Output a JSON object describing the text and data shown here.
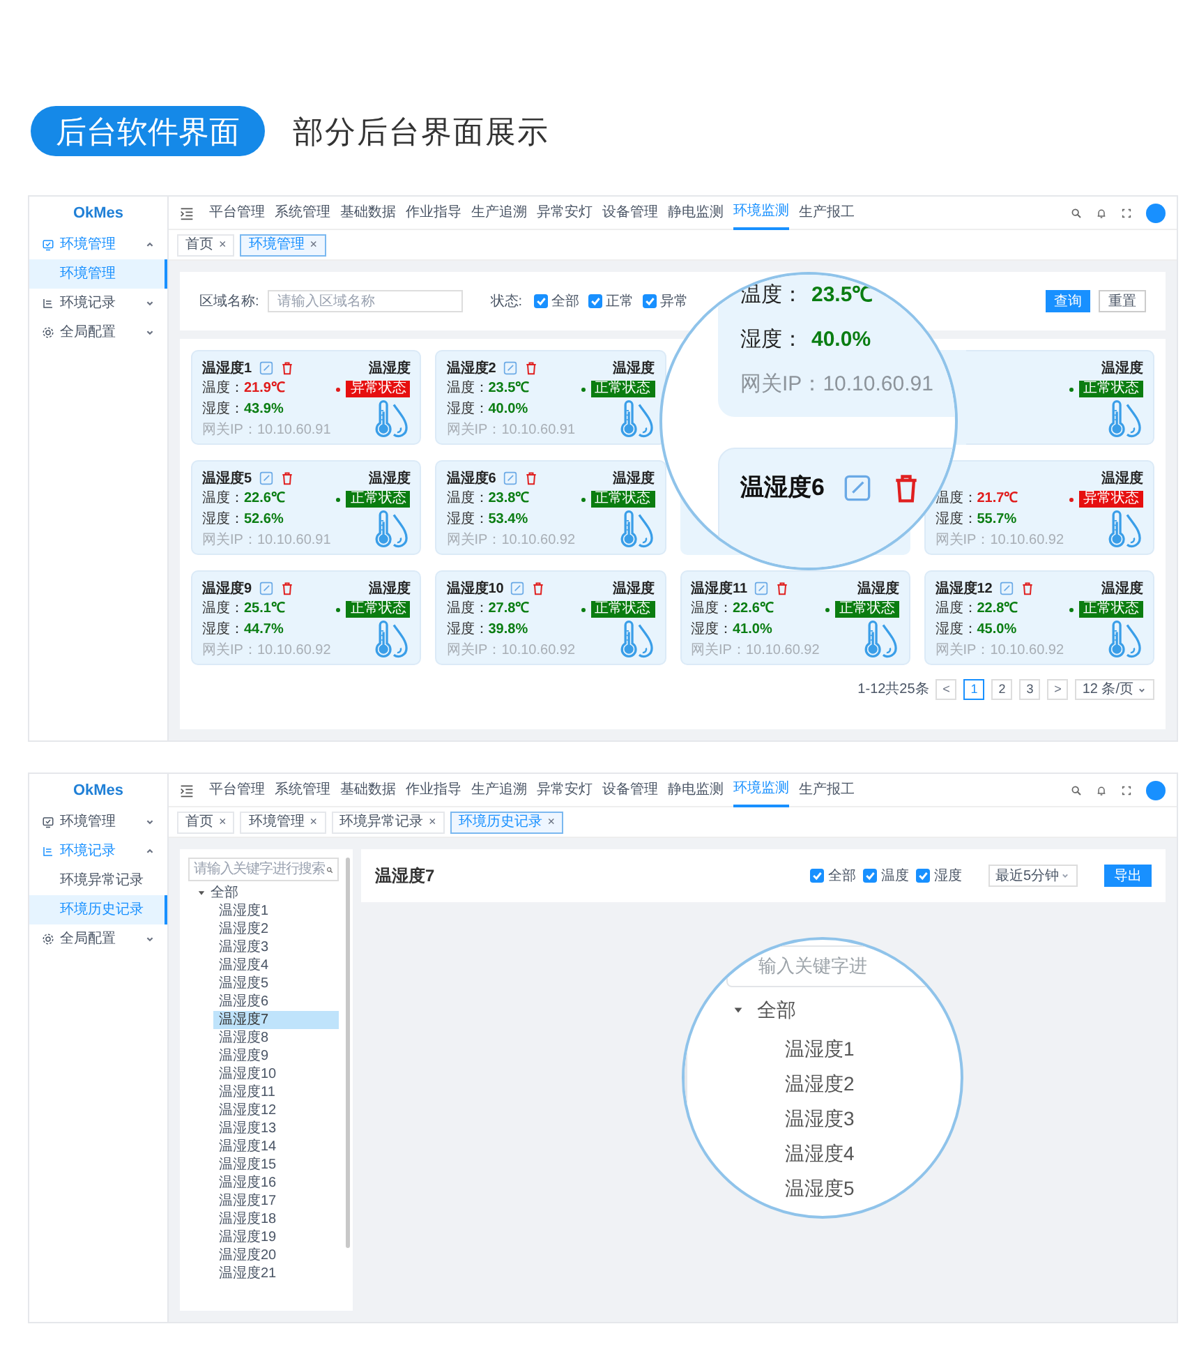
{
  "header": {
    "badge": "后台软件界面",
    "subtitle": "部分后台界面展示"
  },
  "screens": [
    {
      "kind": "monitor",
      "logo": "OkMes",
      "nav": [
        {
          "label": "平台管理",
          "selected": false
        },
        {
          "label": "系统管理",
          "selected": false
        },
        {
          "label": "基础数据",
          "selected": false
        },
        {
          "label": "作业指导",
          "selected": false
        },
        {
          "label": "生产追溯",
          "selected": false
        },
        {
          "label": "异常安灯",
          "selected": false
        },
        {
          "label": "设备管理",
          "selected": false
        },
        {
          "label": "静电监测",
          "selected": false
        },
        {
          "label": "环境监测",
          "selected": true
        },
        {
          "label": "生产报工",
          "selected": false
        }
      ],
      "sidebar": [
        {
          "label": "环境管理",
          "expanded": true,
          "active": true,
          "children": [
            {
              "label": "环境管理",
              "selected": true
            }
          ]
        },
        {
          "label": "环境记录",
          "expanded": false,
          "active": false
        },
        {
          "label": "全局配置",
          "expanded": false,
          "active": false
        }
      ],
      "tabs": [
        {
          "label": "首页",
          "close": "×",
          "selected": false
        },
        {
          "label": "环境管理",
          "close": "×",
          "selected": true
        }
      ],
      "filter": {
        "area_label": "区域名称:",
        "area_placeholder": "请输入区域名称",
        "status_label": "状态:",
        "checks": [
          {
            "label": "全部",
            "checked": true
          },
          {
            "label": "正常",
            "checked": true
          },
          {
            "label": "异常",
            "checked": true
          }
        ],
        "buttons": [
          {
            "label": "查询",
            "kind": "primary"
          },
          {
            "label": "重置",
            "kind": "default"
          }
        ]
      },
      "cards": [
        {
          "kind": "sensor",
          "name": "温湿度1",
          "type_label": "温湿度",
          "temp_label": "温度：",
          "temperature": "21.9℃",
          "abnormal": true,
          "status": "异常状态",
          "hum_label": "湿度：",
          "humidity": "43.9%",
          "ip_label": "网关IP：",
          "ip": "10.10.60.91"
        },
        {
          "kind": "sensor",
          "name": "温湿度2",
          "type_label": "温湿度",
          "temp_label": "温度：",
          "temperature": "23.5℃",
          "abnormal": false,
          "status": "正常状态",
          "hum_label": "湿度：",
          "humidity": "40.0%",
          "ip_label": "网关IP：",
          "ip": "10.10.60.91"
        },
        {
          "kind": "blank"
        },
        {
          "kind": "sensor",
          "type_label": "温湿度",
          "abnormal": false,
          "status": "正常状态"
        },
        {
          "kind": "sensor",
          "name": "温湿度5",
          "type_label": "温湿度",
          "temp_label": "温度：",
          "temperature": "22.6℃",
          "abnormal": false,
          "status": "正常状态",
          "hum_label": "湿度：",
          "humidity": "52.6%",
          "ip_label": "网关IP：",
          "ip": "10.10.60.91"
        },
        {
          "kind": "sensor",
          "name": "温湿度6",
          "type_label": "温湿度",
          "temp_label": "温度：",
          "temperature": "23.8℃",
          "abnormal": false,
          "status": "正常状态",
          "hum_label": "湿度：",
          "humidity": "53.4%",
          "ip_label": "网关IP：",
          "ip": "10.10.60.92"
        },
        {
          "kind": "blank"
        },
        {
          "kind": "sensor",
          "type_label": "温湿度",
          "temp_label": "温度：",
          "temperature": "21.7℃",
          "abnormal": true,
          "status": "异常状态",
          "hum_label": "湿度：",
          "humidity": "55.7%",
          "ip_label": "网关IP：",
          "ip": "10.10.60.92"
        },
        {
          "kind": "sensor",
          "name": "温湿度9",
          "type_label": "温湿度",
          "temp_label": "温度：",
          "temperature": "25.1℃",
          "abnormal": false,
          "status": "正常状态",
          "hum_label": "湿度：",
          "humidity": "44.7%",
          "ip_label": "网关IP：",
          "ip": "10.10.60.92"
        },
        {
          "kind": "sensor",
          "name": "温湿度10",
          "type_label": "温湿度",
          "temp_label": "温度：",
          "temperature": "27.8℃",
          "abnormal": false,
          "status": "正常状态",
          "hum_label": "湿度：",
          "humidity": "39.8%",
          "ip_label": "网关IP：",
          "ip": "10.10.60.92"
        },
        {
          "kind": "sensor",
          "name": "温湿度11",
          "type_label": "温湿度",
          "temp_label": "温度：",
          "temperature": "22.6℃",
          "abnormal": false,
          "status": "正常状态",
          "hum_label": "湿度：",
          "humidity": "41.0%",
          "ip_label": "网关IP：",
          "ip": "10.10.60.92"
        },
        {
          "kind": "sensor",
          "name": "温湿度12",
          "type_label": "温湿度",
          "temp_label": "温度：",
          "temperature": "22.8℃",
          "abnormal": false,
          "status": "正常状态",
          "hum_label": "湿度：",
          "humidity": "45.0%",
          "ip_label": "网关IP：",
          "ip": "10.10.60.92"
        }
      ],
      "pagination": {
        "total": "1-12共25条",
        "prev": "<",
        "pages": [
          {
            "label": "1",
            "selected": true
          },
          {
            "label": "2",
            "selected": false
          },
          {
            "label": "3",
            "selected": false
          }
        ],
        "next": ">",
        "size": "12 条/页"
      },
      "magnifier": {
        "temp_label": "温度：",
        "temperature": "23.5℃",
        "hum_label": "湿度：",
        "humidity": "40.0%",
        "ip_label": "网关IP：",
        "ip": "10.10.60.91",
        "name": "温湿度6"
      }
    },
    {
      "kind": "history",
      "logo": "OkMes",
      "nav": [
        {
          "label": "平台管理",
          "selected": false
        },
        {
          "label": "系统管理",
          "selected": false
        },
        {
          "label": "基础数据",
          "selected": false
        },
        {
          "label": "作业指导",
          "selected": false
        },
        {
          "label": "生产追溯",
          "selected": false
        },
        {
          "label": "异常安灯",
          "selected": false
        },
        {
          "label": "设备管理",
          "selected": false
        },
        {
          "label": "静电监测",
          "selected": false
        },
        {
          "label": "环境监测",
          "selected": true
        },
        {
          "label": "生产报工",
          "selected": false
        }
      ],
      "sidebar": [
        {
          "label": "环境管理",
          "expanded": false,
          "active": false
        },
        {
          "label": "环境记录",
          "expanded": true,
          "active": true,
          "children": [
            {
              "label": "环境异常记录",
              "selected": false
            },
            {
              "label": "环境历史记录",
              "selected": true
            }
          ]
        },
        {
          "label": "全局配置",
          "expanded": false,
          "active": false
        }
      ],
      "tabs": [
        {
          "label": "首页",
          "close": "×",
          "selected": false
        },
        {
          "label": "环境管理",
          "close": "×",
          "selected": false
        },
        {
          "label": "环境异常记录",
          "close": "×",
          "selected": false
        },
        {
          "label": "环境历史记录",
          "close": "×",
          "selected": true
        }
      ],
      "tree": {
        "placeholder": "请输入关键字进行搜索",
        "root": {
          "label": "全部",
          "expanded": true,
          "children": [
            {
              "label": "温湿度1",
              "selected": false
            },
            {
              "label": "温湿度2",
              "selected": false
            },
            {
              "label": "温湿度3",
              "selected": false
            },
            {
              "label": "温湿度4",
              "selected": false
            },
            {
              "label": "温湿度5",
              "selected": false
            },
            {
              "label": "温湿度6",
              "selected": false
            },
            {
              "label": "温湿度7",
              "selected": true
            },
            {
              "label": "温湿度8",
              "selected": false
            },
            {
              "label": "温湿度9",
              "selected": false
            },
            {
              "label": "温湿度10",
              "selected": false
            },
            {
              "label": "温湿度11",
              "selected": false
            },
            {
              "label": "温湿度12",
              "selected": false
            },
            {
              "label": "温湿度13",
              "selected": false
            },
            {
              "label": "温湿度14",
              "selected": false
            },
            {
              "label": "温湿度15",
              "selected": false
            },
            {
              "label": "温湿度16",
              "selected": false
            },
            {
              "label": "温湿度17",
              "selected": false
            },
            {
              "label": "温湿度18",
              "selected": false
            },
            {
              "label": "温湿度19",
              "selected": false
            },
            {
              "label": "温湿度20",
              "selected": false
            },
            {
              "label": "温湿度21",
              "selected": false
            }
          ]
        }
      },
      "panel": {
        "title": "温湿度7",
        "checks": [
          {
            "label": "全部",
            "checked": true
          },
          {
            "label": "温度",
            "checked": true
          },
          {
            "label": "湿度",
            "checked": true
          }
        ],
        "select": "最近5分钟",
        "button": "导出"
      },
      "magnifier": {
        "placeholder": "输入关键字进",
        "root_label": "全部",
        "items": [
          "温湿度1",
          "温湿度2",
          "温湿度3",
          "温湿度4",
          "温湿度5"
        ]
      }
    }
  ]
}
